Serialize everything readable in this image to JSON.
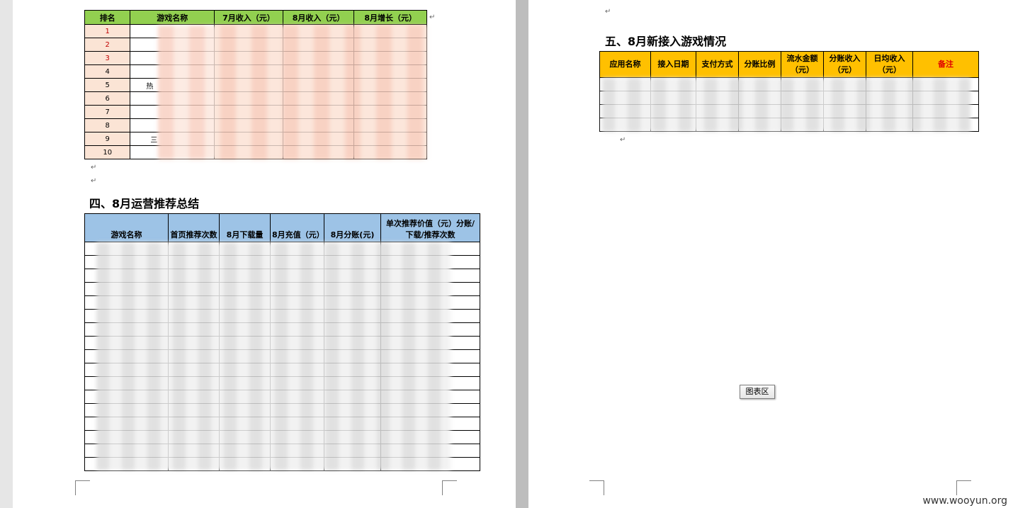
{
  "left_page": {
    "table_rank": {
      "headers": [
        "排名",
        "游戏名称",
        "7月收入（元）",
        "8月收入（元）",
        "8月增长（元）"
      ],
      "ranks": [
        "1",
        "2",
        "3",
        "4",
        "5",
        "6",
        "7",
        "8",
        "9",
        "10"
      ],
      "partial_text_row5": "热",
      "partial_text_row9": "三"
    },
    "section4_title": "四、8月运营推荐总结",
    "table_ops": {
      "headers": [
        "游戏名称",
        "首页推荐次数",
        "8月下载量",
        "8月充值（元）",
        "8月分账(元)",
        "单次推荐价值（元）分账/下载/推荐次数"
      ],
      "row_count": 17
    }
  },
  "right_page": {
    "section5_title": "五、8月新接入游戏情况",
    "table_new": {
      "headers": [
        "应用名称",
        "接入日期",
        "支付方式",
        "分账比例",
        "流水金额（元）",
        "分账收入（元）",
        "日均收入（元）",
        "备注"
      ],
      "row_count": 4
    },
    "chart_button_label": "图表区"
  },
  "watermark": "www.wooyun.org",
  "colors": {
    "rank_header": "#92d050",
    "rank_cell": "#fbe4d5",
    "ops_header": "#9dc3e6",
    "new_header": "#ffc000"
  }
}
